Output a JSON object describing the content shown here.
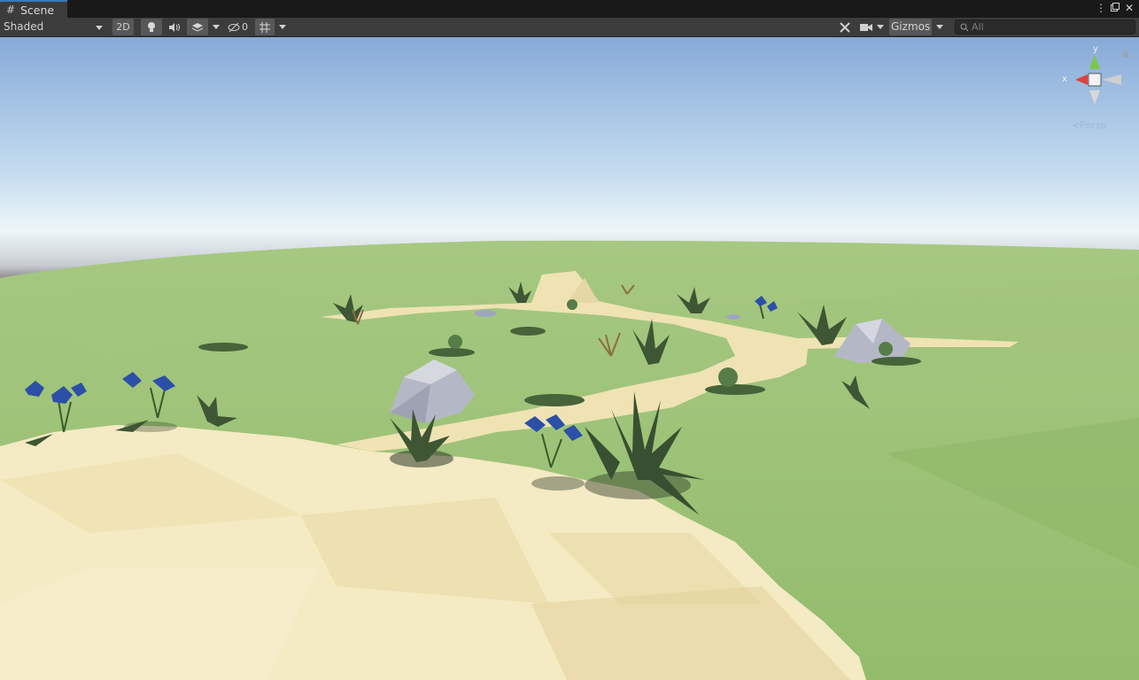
{
  "window": {
    "tab_label": "Scene",
    "tab_icon": "grid-hash-icon"
  },
  "toolbar": {
    "shading_mode": "Shaded",
    "mode_2d_label": "2D",
    "hidden_count": "0",
    "gizmos_label": "Gizmos",
    "search_placeholder": "All"
  },
  "orientation_gizmo": {
    "x_label": "x",
    "y_label": "y",
    "projection_label": "Persp",
    "colors": {
      "x_axis": "#e0403a",
      "y_axis": "#7ac943",
      "z_axis": "#d8d8d8"
    }
  },
  "scene_colors": {
    "sky_top": "#88acd8",
    "sky_horizon": "#eef6f9",
    "grass": "#98be6c",
    "sand_path": "#f3e9c0",
    "rock": "#b2b6c4",
    "flower": "#2c4fa8",
    "leaf": "#3f5a33"
  }
}
